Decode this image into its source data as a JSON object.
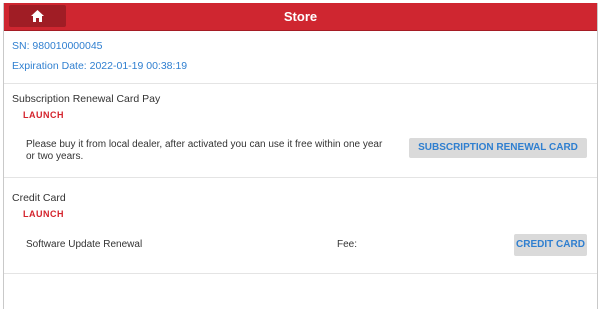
{
  "header": {
    "title": "Store",
    "home_icon": "home-icon"
  },
  "device": {
    "sn": "SN: 980010000045",
    "expiration": "Expiration Date: 2022-01-19 00:38:19"
  },
  "sections": [
    {
      "title": "Subscription Renewal Card Pay",
      "brand": "LAUNCH",
      "description": "Please buy it from local dealer, after activated you can use it free within one year or two years.",
      "button_label": "SUBSCRIPTION RENEWAL CARD"
    },
    {
      "title": "Credit Card",
      "brand": "LAUNCH",
      "item": "Software Update Renewal",
      "fee_label": "Fee:",
      "button_label": "CREDIT CARD"
    }
  ],
  "colors": {
    "header": "#cf2630",
    "link": "#2f7fd0",
    "brand": "#d4232c"
  }
}
